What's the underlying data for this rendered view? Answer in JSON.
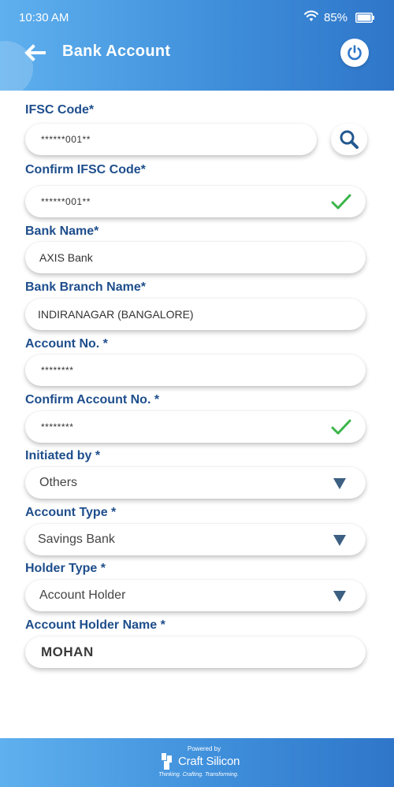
{
  "status_bar": {
    "time": "10:30 AM",
    "battery": "85%"
  },
  "header": {
    "title": "Bank Account"
  },
  "form": {
    "ifsc": {
      "label": "IFSC Code*",
      "value": "******001**"
    },
    "confirm_ifsc": {
      "label": "Confirm IFSC Code*",
      "value": "******001**"
    },
    "bank_name": {
      "label": "Bank Name*",
      "value": "AXIS Bank"
    },
    "branch_name": {
      "label": "Bank Branch Name*",
      "value": "INDIRANAGAR (BANGALORE)"
    },
    "account_no": {
      "label": "Account No. *",
      "value": "********"
    },
    "confirm_account_no": {
      "label": "Confirm Account No. *",
      "value": "********"
    },
    "initiated_by": {
      "label": "Initiated by *",
      "value": "Others"
    },
    "account_type": {
      "label": "Account Type *",
      "value": "Savings Bank"
    },
    "holder_type": {
      "label": "Holder Type *",
      "value": "Account Holder"
    },
    "holder_name": {
      "label": "Account Holder Name *",
      "value": "MOHAN"
    }
  },
  "footer": {
    "powered_by": "Powered by",
    "brand": "Craft Silicon",
    "tagline": "Thinking. Crafting. Transforming."
  },
  "colors": {
    "header_gradient_start": "#5fb0ee",
    "header_gradient_end": "#2f76c9",
    "label": "#1e4e8c",
    "check": "#3bb54a",
    "caret": "#3c5f82"
  },
  "icons": {
    "back": "arrow-left-icon",
    "power": "power-icon",
    "search": "search-icon",
    "check": "checkmark-icon",
    "caret": "triangle-down-icon",
    "wifi": "wifi-icon",
    "battery": "battery-icon",
    "logo": "craft-silicon-logo-icon"
  }
}
